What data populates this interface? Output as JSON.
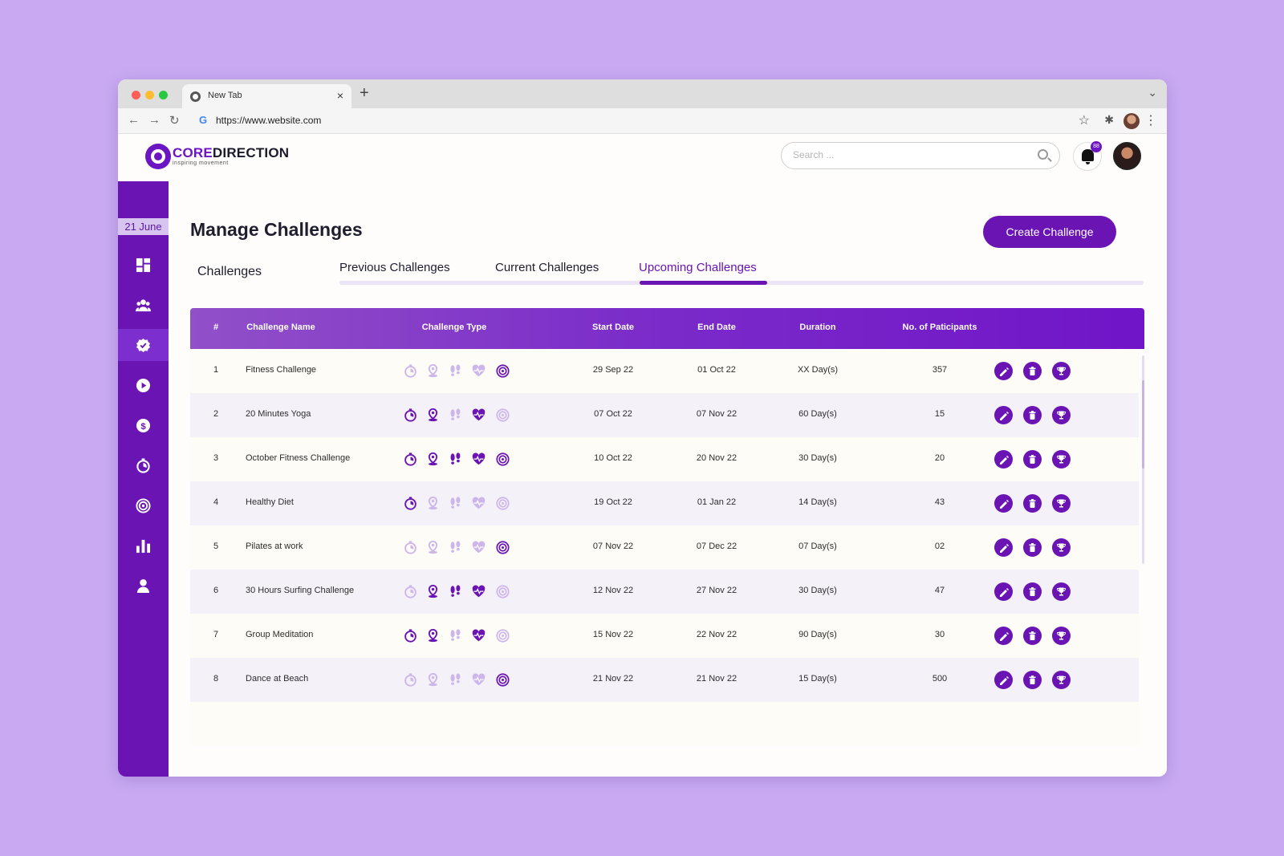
{
  "browser": {
    "tab_title": "New Tab",
    "tab_close": "×",
    "new_tab": "+",
    "menu_chevron": "⌄",
    "url": "https://www.website.com",
    "url_icon": "G"
  },
  "header": {
    "logo_core": "CORE",
    "logo_rest": "DIRECTION",
    "logo_tagline": "inspiring movement",
    "search_placeholder": "Search ...",
    "notification_count": "88"
  },
  "sidebar": {
    "date": "21 June",
    "items": [
      {
        "icon": "dashboard-icon",
        "active": false
      },
      {
        "icon": "users-icon",
        "active": false
      },
      {
        "icon": "challenges-badge-icon",
        "active": true
      },
      {
        "icon": "play-icon",
        "active": false
      },
      {
        "icon": "dollar-icon",
        "active": false
      },
      {
        "icon": "timer-icon",
        "active": false
      },
      {
        "icon": "target-icon",
        "active": false
      },
      {
        "icon": "bar-chart-icon",
        "active": false
      },
      {
        "icon": "profile-icon",
        "active": false
      }
    ]
  },
  "main": {
    "title": "Manage Challenges",
    "create_label": "Create Challenge",
    "left_tab": "Challenges",
    "tabs": [
      "Previous Challenges",
      "Current Challenges",
      "Upcoming Challenges"
    ],
    "active_tab": 2
  },
  "table": {
    "headers": [
      "#",
      "Challenge Name",
      "Challenge Type",
      "Start Date",
      "End Date",
      "Duration",
      "No. of Paticipants"
    ],
    "type_icons": [
      "timer-icon",
      "location-icon",
      "footsteps-icon",
      "heart-rate-icon",
      "target-icon"
    ],
    "rows": [
      {
        "num": "1",
        "name": "Fitness Challenge",
        "start": "29 Sep 22",
        "end": "01 Oct 22",
        "duration": "XX Day(s)",
        "participants": "357",
        "types": [
          false,
          false,
          false,
          false,
          true
        ]
      },
      {
        "num": "2",
        "name": "20 Minutes Yoga",
        "start": "07 Oct 22",
        "end": "07 Nov 22",
        "duration": "60 Day(s)",
        "participants": "15",
        "types": [
          true,
          true,
          false,
          true,
          false
        ]
      },
      {
        "num": "3",
        "name": "October Fitness Challenge",
        "start": "10 Oct 22",
        "end": "20 Nov 22",
        "duration": "30 Day(s)",
        "participants": "20",
        "types": [
          true,
          true,
          true,
          true,
          true
        ]
      },
      {
        "num": "4",
        "name": "Healthy Diet",
        "start": "19 Oct 22",
        "end": "01 Jan 22",
        "duration": "14 Day(s)",
        "participants": "43",
        "types": [
          true,
          false,
          false,
          false,
          false
        ]
      },
      {
        "num": "5",
        "name": "Pilates at work",
        "start": "07 Nov 22",
        "end": "07 Dec 22",
        "duration": "07 Day(s)",
        "participants": "02",
        "types": [
          false,
          false,
          false,
          false,
          true
        ]
      },
      {
        "num": "6",
        "name": "30 Hours Surfing Challenge",
        "start": "12 Nov 22",
        "end": "27 Nov 22",
        "duration": "30 Day(s)",
        "participants": "47",
        "types": [
          false,
          true,
          true,
          true,
          false
        ]
      },
      {
        "num": "7",
        "name": "Group Meditation",
        "start": "15 Nov 22",
        "end": "22 Nov 22",
        "duration": "90 Day(s)",
        "participants": "30",
        "types": [
          true,
          true,
          false,
          true,
          false
        ]
      },
      {
        "num": "8",
        "name": "Dance at Beach",
        "start": "21 Nov 22",
        "end": "21 Nov 22",
        "duration": "15 Day(s)",
        "participants": "500",
        "types": [
          false,
          false,
          false,
          false,
          true
        ]
      }
    ],
    "actions": [
      "edit-icon",
      "delete-icon",
      "trophy-icon"
    ]
  },
  "colors": {
    "brand": "#6a14b4",
    "background": "#c8a9f2",
    "icon_active": "#6a14b4",
    "icon_inactive": "#cdb6ea"
  }
}
